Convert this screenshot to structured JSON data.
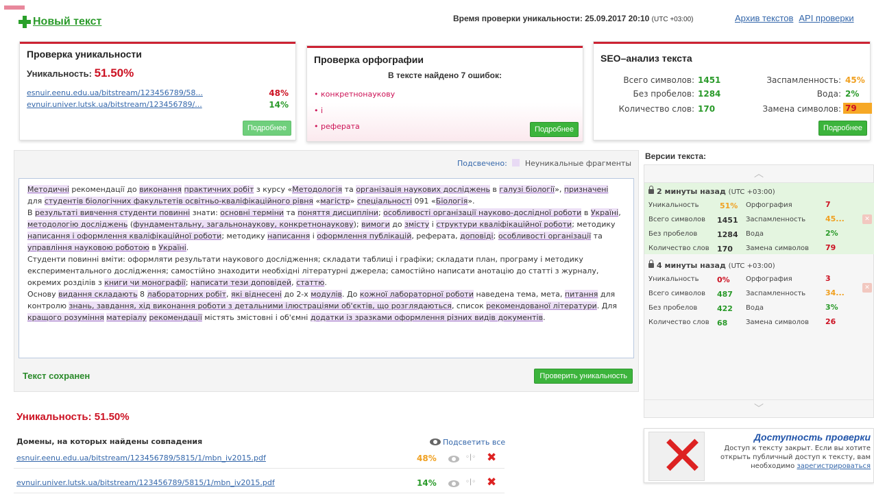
{
  "header": {
    "new_text_label": "Новый текст",
    "check_time_label": "Время проверки уникальности: 25.09.2017 20:10",
    "check_time_tz": "(UTC +03:00)",
    "archive_link": "Архив текстов",
    "api_link": "API проверки"
  },
  "uniqueness_panel": {
    "title": "Проверка уникальности",
    "label": "Уникальность:",
    "value": "51.50%",
    "sources": [
      {
        "url": "esnuir.eenu.edu.ua/bitstream/123456789/58...",
        "pct": "48%"
      },
      {
        "url": "evnuir.univer.lutsk.ua/bitstream/123456789/...",
        "pct": "14%"
      }
    ],
    "more_button": "Подробнее"
  },
  "spelling_panel": {
    "title": "Проверка орфографии",
    "summary": "В тексте найдено 7 ошибок:",
    "errors": [
      "конкретнонаукову",
      "і",
      "реферата"
    ],
    "more_button": "Подробнее"
  },
  "seo_panel": {
    "title": "SEO–анализ текста",
    "total_chars_label": "Всего символов:",
    "total_chars": "1451",
    "no_spaces_label": "Без пробелов:",
    "no_spaces": "1284",
    "words_label": "Количество слов:",
    "words": "170",
    "spam_label": "Заспамленность:",
    "spam": "45%",
    "water_label": "Вода:",
    "water": "2%",
    "replace_label": "Замена символов:",
    "replace": "79",
    "more_button": "Подробнее"
  },
  "editor": {
    "legend_label": "Подсвечено:",
    "legend_text": "Неуникальные фрагменты",
    "saved_label": "Текст сохранен",
    "check_button": "Проверить уникальность",
    "paragraphs": [
      [
        {
          "t": "Методичні",
          "h": true
        },
        {
          "t": " рекомендації до "
        },
        {
          "t": "виконання",
          "h": true
        },
        {
          "t": " "
        },
        {
          "t": "практичних робіт",
          "h": true
        },
        {
          "t": " з курсу «"
        },
        {
          "t": "Методологія",
          "h": true
        },
        {
          "t": " та "
        },
        {
          "t": "організація наукових досліджень",
          "h": true
        },
        {
          "t": " в "
        },
        {
          "t": "галузі біології",
          "h": true
        },
        {
          "t": "», "
        },
        {
          "t": "призначені",
          "h": true
        },
        {
          "t": " для "
        },
        {
          "t": "студентів біологічних факультетів освітньо-кваліфікаційного рівня",
          "h": true
        },
        {
          "t": " «"
        },
        {
          "t": "магістр",
          "h": true
        },
        {
          "t": "» "
        },
        {
          "t": "спеціальності",
          "h": true
        },
        {
          "t": " 091 «"
        },
        {
          "t": "Біологія",
          "h": true
        },
        {
          "t": "»."
        }
      ],
      [
        {
          "t": "В "
        },
        {
          "t": "результаті вивчення студенти повинні",
          "h": true
        },
        {
          "t": " знати: "
        },
        {
          "t": "основні терміни",
          "h": true
        },
        {
          "t": " та "
        },
        {
          "t": "поняття дисципліни",
          "h": true
        },
        {
          "t": "; "
        },
        {
          "t": "особливості організації науково-дослідної роботи",
          "h": true
        },
        {
          "t": " в "
        },
        {
          "t": "Україні",
          "h": true
        },
        {
          "t": ", "
        },
        {
          "t": "методологію досліджень",
          "h": true
        },
        {
          "t": " ("
        },
        {
          "t": "фундаментальну, загальнонаукову, конкретнонаукову",
          "h": true
        },
        {
          "t": "); "
        },
        {
          "t": "вимоги",
          "h": true
        },
        {
          "t": " до "
        },
        {
          "t": "змісту",
          "h": true
        },
        {
          "t": " і "
        },
        {
          "t": "структури кваліфікаційної роботи",
          "h": true
        },
        {
          "t": "; методику "
        },
        {
          "t": "написання і оформлення кваліфікаційної роботи",
          "h": true
        },
        {
          "t": "; методику "
        },
        {
          "t": "написання",
          "h": true
        },
        {
          "t": " і "
        },
        {
          "t": "оформлення публікацій",
          "h": true
        },
        {
          "t": ", реферата, "
        },
        {
          "t": "доповіді",
          "h": true
        },
        {
          "t": "; "
        },
        {
          "t": "особливості організації",
          "h": true
        },
        {
          "t": " та "
        },
        {
          "t": "управління науковою роботою",
          "h": true
        },
        {
          "t": " в "
        },
        {
          "t": "Україні",
          "h": true
        },
        {
          "t": "."
        }
      ],
      [
        {
          "t": "Студенти повинні вміти: оформляти результати наукового дослідження; складати таблиці і графіки; складати план, програму і методику експериментального дослідження; самостійно знаходити необхідні літературні джерела; самостійно написати анотацію до статті з журналу, окремих розділів з "
        },
        {
          "t": "книги чи монографії",
          "h": true
        },
        {
          "t": "; "
        },
        {
          "t": "написати тези доповідей",
          "h": true
        },
        {
          "t": ", "
        },
        {
          "t": "статтю",
          "h": true
        },
        {
          "t": "."
        }
      ],
      [
        {
          "t": "Основу "
        },
        {
          "t": "видання складають",
          "h": true
        },
        {
          "t": " 8 "
        },
        {
          "t": "лабораторних робіт",
          "h": true
        },
        {
          "t": ", "
        },
        {
          "t": "які віднесені",
          "h": true
        },
        {
          "t": " до 2-х "
        },
        {
          "t": "модулів",
          "h": true
        },
        {
          "t": ". До "
        },
        {
          "t": "кожної лабораторної роботи",
          "h": true
        },
        {
          "t": " наведена тема, мета, "
        },
        {
          "t": "питання",
          "h": true
        },
        {
          "t": " для контролю "
        },
        {
          "t": "знань, завдання, хід виконання роботи з детальними ілюстраціями об'єктів, що розглядаються",
          "h": true
        },
        {
          "t": ", список "
        },
        {
          "t": "рекомендованої літератури",
          "h": true
        },
        {
          "t": ". Для "
        },
        {
          "t": "кращого розуміння",
          "h": true
        },
        {
          "t": " "
        },
        {
          "t": "матеріалу",
          "h": true
        },
        {
          "t": " "
        },
        {
          "t": "рекомендації",
          "h": true
        },
        {
          "t": " містять змістовні і об'ємні "
        },
        {
          "t": "додатки із зразками оформлення різних видів документів",
          "h": true
        },
        {
          "t": "."
        }
      ]
    ]
  },
  "results": {
    "uniqueness_label": "Уникальность: 51.50%",
    "domains_title": "Домены, на которых найдены совпадения",
    "highlight_all": "Подсветить все",
    "domains": [
      {
        "url": "esnuir.eenu.edu.ua/bitstream/123456789/5815/1/mbn_iv2015.pdf",
        "pct": "48%",
        "cmp": "◦|◦"
      },
      {
        "url": "evnuir.univer.lutsk.ua/bitstream/123456789/5815/1/mbn_iv2015.pdf",
        "pct": "14%",
        "cmp": "◦|◦"
      }
    ]
  },
  "versions": {
    "title": "Версии текста:",
    "up_arrow": "︿",
    "down_arrow": "﹀",
    "items": [
      {
        "time": "2 минуты назад",
        "tz": "(UTC +03:00)",
        "uniq_label": "Уникальность",
        "uniq": "51%",
        "spell_label": "Орфография",
        "spell": "7",
        "chars_label": "Всего символов",
        "chars": "1451",
        "spam_label": "Заспамленность",
        "spam": "45...",
        "nospace_label": "Без пробелов",
        "nospace": "1284",
        "water_label": "Вода",
        "water": "2%",
        "words_label": "Количество слов",
        "words": "170",
        "replace_label": "Замена символов",
        "replace": "79"
      },
      {
        "time": "4 минуты назад",
        "tz": "(UTC +03:00)",
        "uniq_label": "Уникальность",
        "uniq": "0%",
        "spell_label": "Орфография",
        "spell": "3",
        "chars_label": "Всего символов",
        "chars": "487",
        "spam_label": "Заспамленность",
        "spam": "34...",
        "nospace_label": "Без пробелов",
        "nospace": "422",
        "water_label": "Вода",
        "water": "3%",
        "words_label": "Количество слов",
        "words": "68",
        "replace_label": "Замена символов",
        "replace": "26"
      }
    ]
  },
  "promo": {
    "title": "Доступность проверки",
    "text": "Доступ к тексту закрыт. Если вы хотите открыть публичный доступ к тексту, вам необходимо",
    "link": "зарегистрироваться"
  }
}
